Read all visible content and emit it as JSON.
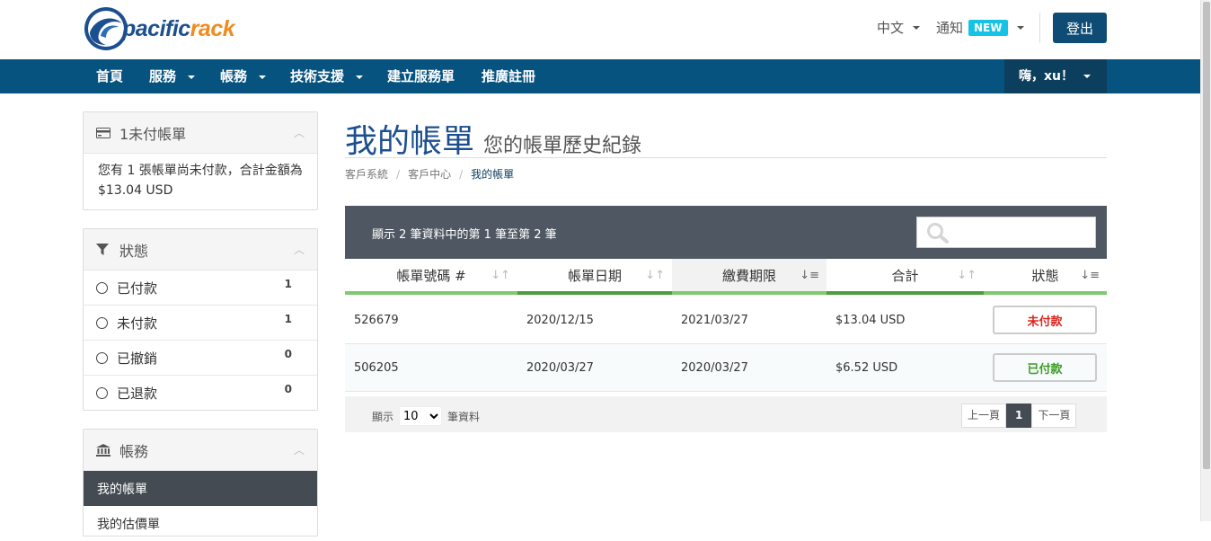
{
  "brand": {
    "name_part1": "pacific",
    "name_part2": "rack",
    "colors": {
      "blue": "#1c4f8f",
      "orange": "#f28b1e"
    }
  },
  "topbar": {
    "language": "中文",
    "notifications": "通知",
    "notifications_badge": "NEW",
    "logout": "登出"
  },
  "nav": {
    "items": [
      {
        "label": "首頁",
        "icon": "",
        "dropdown": false
      },
      {
        "label": "服務",
        "dropdown": true
      },
      {
        "label": "帳務",
        "dropdown": true
      },
      {
        "label": "技術支援",
        "dropdown": true
      },
      {
        "label": "建立服務單",
        "dropdown": false
      },
      {
        "label": "推廣註冊",
        "dropdown": false
      }
    ],
    "user_greeting": "嗨，xu！"
  },
  "sidebar": {
    "unpaid": {
      "title": "1未付帳單",
      "icon": "credit-card-icon",
      "message": "您有 1 張帳單尚未付款，合計金額為 $13.04 USD"
    },
    "status": {
      "title": "狀態",
      "icon": "filter-icon",
      "items": [
        {
          "label": "已付款",
          "count": "1"
        },
        {
          "label": "未付款",
          "count": "1"
        },
        {
          "label": "已撤銷",
          "count": "0"
        },
        {
          "label": "已退款",
          "count": "0"
        }
      ]
    },
    "billing": {
      "title": "帳務",
      "icon": "bank-icon",
      "items": [
        {
          "label": "我的帳單",
          "active": true
        },
        {
          "label": "我的估價單",
          "active": false
        }
      ]
    }
  },
  "page": {
    "title": "我的帳單",
    "subtitle": "您的帳單歷史紀錄",
    "breadcrumb": [
      "客戶系統",
      "客戶中心",
      "我的帳單"
    ]
  },
  "table": {
    "info": "顯示 2 筆資料中的第 1 筆至第 2 筆",
    "search_placeholder": "",
    "columns": [
      "帳單號碼 #",
      "帳單日期",
      "繳費期限",
      "合計",
      "狀態"
    ],
    "rows": [
      {
        "id": "526679",
        "date": "2020/12/15",
        "due": "2021/03/27",
        "total": "$13.04 USD",
        "status": "未付款",
        "status_color": "#d9251d"
      },
      {
        "id": "506205",
        "date": "2020/03/27",
        "due": "2020/03/27",
        "total": "$6.52 USD",
        "status": "已付款",
        "status_color": "#3b9b25"
      }
    ],
    "footer": {
      "show": "顯示",
      "page_size": "10",
      "suffix": "筆資料",
      "prev": "上一頁",
      "current_page": "1",
      "next": "下一頁"
    }
  }
}
